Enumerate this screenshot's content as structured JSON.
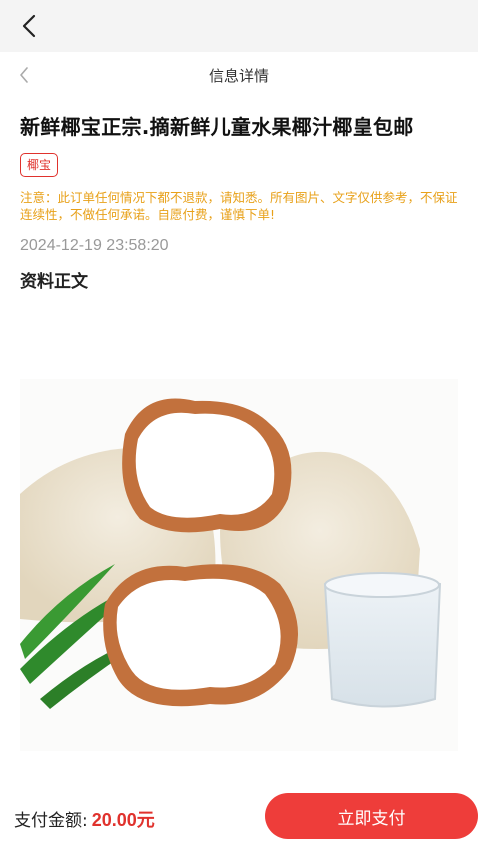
{
  "header": {
    "back_icon": "chevron-left-icon"
  },
  "nav": {
    "title": "信息详情",
    "back_icon": "chevron-left-icon"
  },
  "product": {
    "title": "新鲜椰宝正宗.摘新鲜儿童水果椰汁椰皇包邮",
    "tag": "椰宝",
    "notice": "注意：此订单任何情况下都不退款，请知悉。所有图片、文字仅供参考，不保证连续性，不做任何承诺。自愿付费，谨慎下单!",
    "date": "2024-12-19 23:58:20",
    "section_title": "资料正文",
    "image": "coconut-product-photo"
  },
  "footer": {
    "price_label": "支付金额:",
    "price_value": "20.00元",
    "pay_button": "立即支付"
  },
  "colors": {
    "accent": "#ee3d3a",
    "notice": "#e8a11a",
    "date": "#999999"
  }
}
